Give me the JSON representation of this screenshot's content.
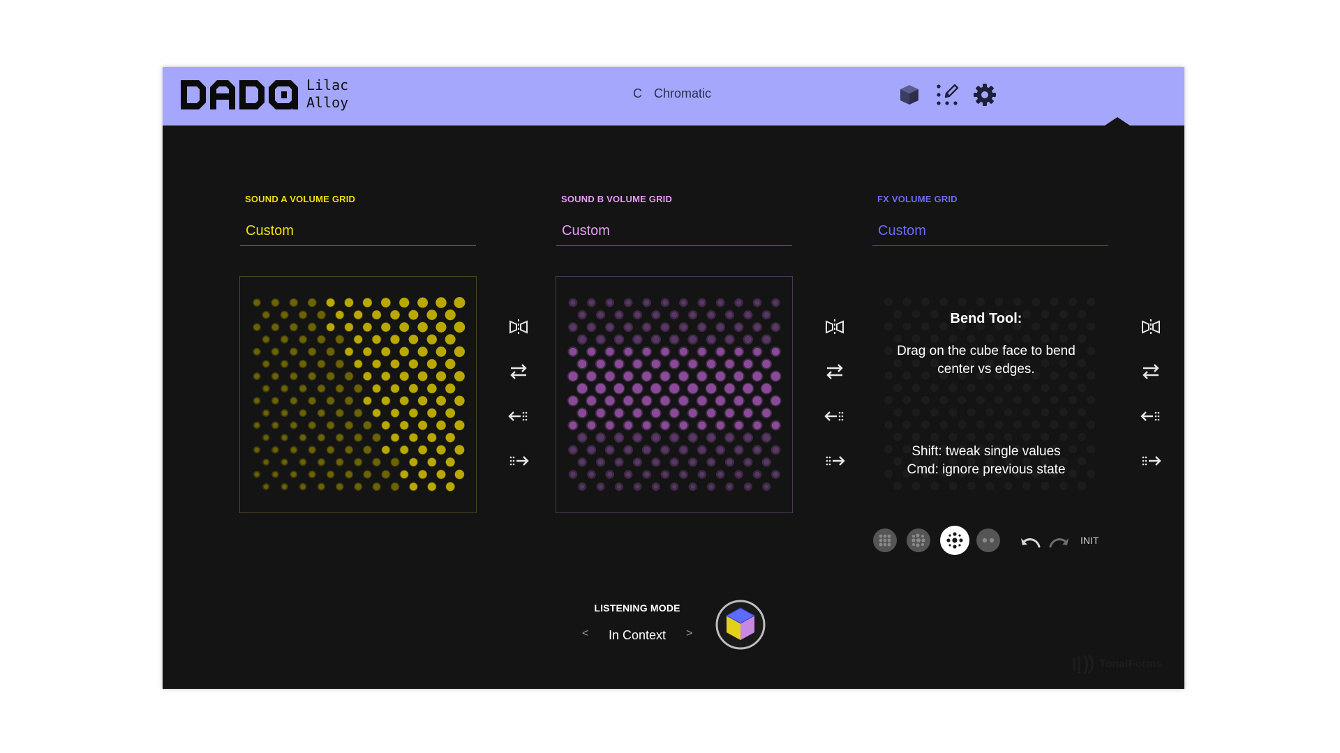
{
  "app": {
    "logo_text": "DADO",
    "preset_line1": "Lilac",
    "preset_line2": "Alloy",
    "scale_key": "C",
    "scale_name": "Chromatic",
    "icons": [
      "cube-icon",
      "edit-grid-icon",
      "gear-icon"
    ],
    "brand": "TonalForms"
  },
  "sections": [
    {
      "title": "SOUND A VOLUME GRID",
      "preset": "Custom",
      "color": "#f0e000"
    },
    {
      "title": "SOUND B VOLUME GRID",
      "preset": "Custom",
      "color": "#e79cf6"
    },
    {
      "title": "FX VOLUME GRID",
      "preset": "Custom",
      "color": "#6b6bf7"
    }
  ],
  "grid_tools": [
    "mirror-icon",
    "swap-icon",
    "shift-left-icon",
    "shift-right-icon"
  ],
  "bend_tool": {
    "title": "Bend Tool:",
    "desc_line1": "Drag on the cube face to bend",
    "desc_line2": "center vs edges.",
    "hint_line1": "Shift: tweak single values",
    "hint_line2": "Cmd: ignore previous state"
  },
  "edit_tools": {
    "options": [
      "grid-9-icon",
      "grid-pattern-icon",
      "bend-tool-icon",
      "two-dots-icon"
    ],
    "selected": "bend-tool-icon",
    "init_label": "INIT"
  },
  "listening_mode": {
    "title": "LISTENING MODE",
    "value": "In Context",
    "prev": "<",
    "next": ">"
  }
}
